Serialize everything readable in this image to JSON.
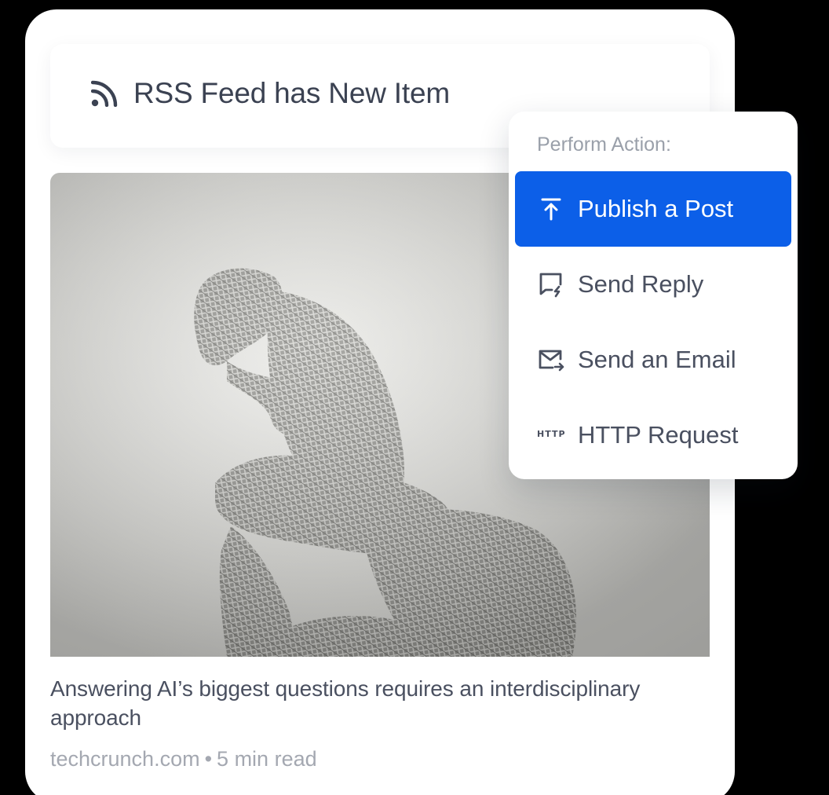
{
  "trigger": {
    "icon": "rss-icon",
    "title": "RSS Feed has New Item"
  },
  "article": {
    "image": "wire-thinker-sculpture-image",
    "headline": "Answering AI’s biggest questions requires an interdisciplinary approach",
    "source": "techcrunch.com",
    "separator": "•",
    "read_time": "5 min read"
  },
  "action_menu": {
    "heading": "Perform Action:",
    "items": [
      {
        "label": "Publish a Post",
        "icon": "upload-icon",
        "selected": true
      },
      {
        "label": "Send Reply",
        "icon": "reply-message-icon",
        "selected": false
      },
      {
        "label": "Send an Email",
        "icon": "email-forward-icon",
        "selected": false
      },
      {
        "label": "HTTP Request",
        "icon": "http-icon",
        "icon_text": "HTTP",
        "selected": false
      }
    ]
  },
  "colors": {
    "accent": "#0c5fe8",
    "text_primary": "#3b4252",
    "text_muted": "#a4a8b1",
    "background": "#ffffff"
  }
}
